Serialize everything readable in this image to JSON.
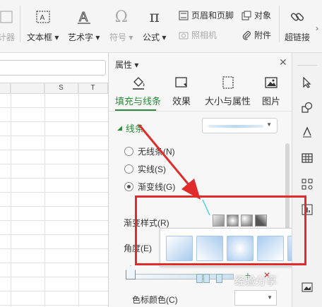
{
  "ribbon": {
    "partial_left_label": "计器",
    "textbox_label": "文本框",
    "wordart_label": "艺术字",
    "symbol_label": "符号",
    "formula_label": "公式",
    "header_footer_label": "页眉和页脚",
    "camera_label": "照相机",
    "object_label": "对象",
    "attachment_label": "附件",
    "hyperlink_label": "超链接"
  },
  "sheet": {
    "columns": [
      "S",
      "T"
    ]
  },
  "panel": {
    "title": "属性",
    "tabs": [
      {
        "label": "填充与线条",
        "icon": "fill-bucket-icon",
        "active": true
      },
      {
        "label": "效果",
        "icon": "effect-icon",
        "active": false
      },
      {
        "label": "大小与属性",
        "icon": "size-icon",
        "active": false
      },
      {
        "label": "图片",
        "icon": "picture-icon",
        "active": false
      }
    ],
    "section_title": "线条",
    "radios": [
      {
        "label": "无线条(N)",
        "checked": false
      },
      {
        "label": "实线(S)",
        "checked": false
      },
      {
        "label": "渐变线(G)",
        "checked": true
      }
    ],
    "gradient_style_label": "渐变样式(R)",
    "angle_label": "角度(E)",
    "stop_color_label": "色标颜色(C)"
  },
  "popup": {
    "preset_count": 5
  },
  "watermark": "经验分享",
  "colors": {
    "accent_green": "#2a8c3a",
    "annotation_red": "#e12a2a",
    "gradient_blue": "#b8d8f2"
  }
}
